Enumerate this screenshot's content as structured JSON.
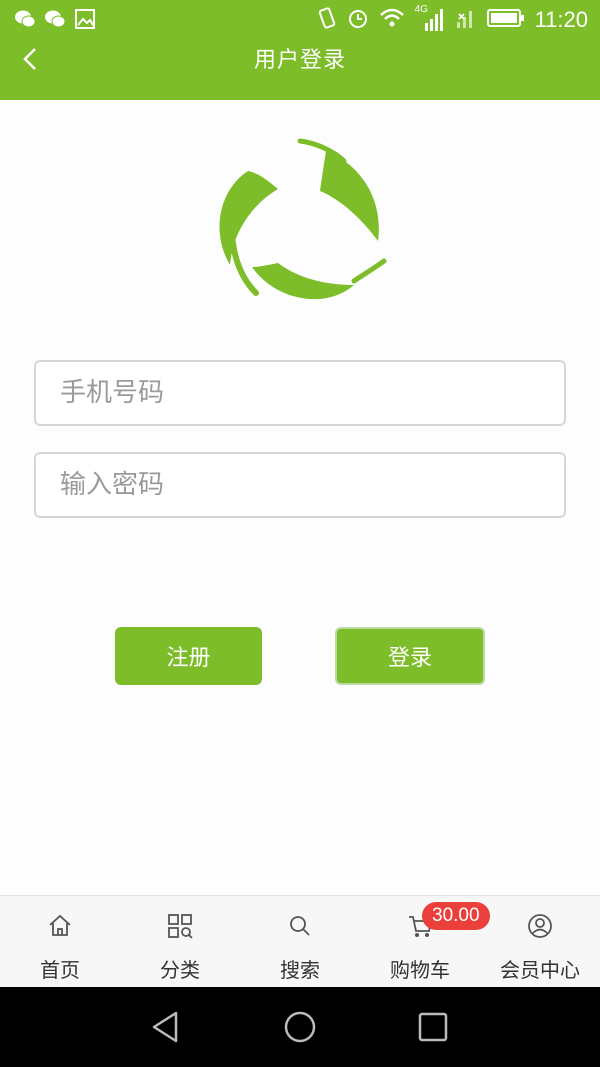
{
  "status_bar": {
    "time": "11:20",
    "network": "4G"
  },
  "header": {
    "title": "用户登录"
  },
  "form": {
    "phone_placeholder": "手机号码",
    "password_placeholder": "输入密码",
    "register_label": "注册",
    "login_label": "登录"
  },
  "bottom_nav": {
    "items": [
      {
        "label": "首页",
        "icon": "home-icon"
      },
      {
        "label": "分类",
        "icon": "category-icon"
      },
      {
        "label": "搜索",
        "icon": "search-icon"
      },
      {
        "label": "购物车",
        "icon": "cart-icon",
        "badge": "30.00"
      },
      {
        "label": "会员中心",
        "icon": "member-icon"
      }
    ]
  },
  "colors": {
    "brand_green": "#7dbd2a",
    "badge_red": "#e9403c"
  }
}
